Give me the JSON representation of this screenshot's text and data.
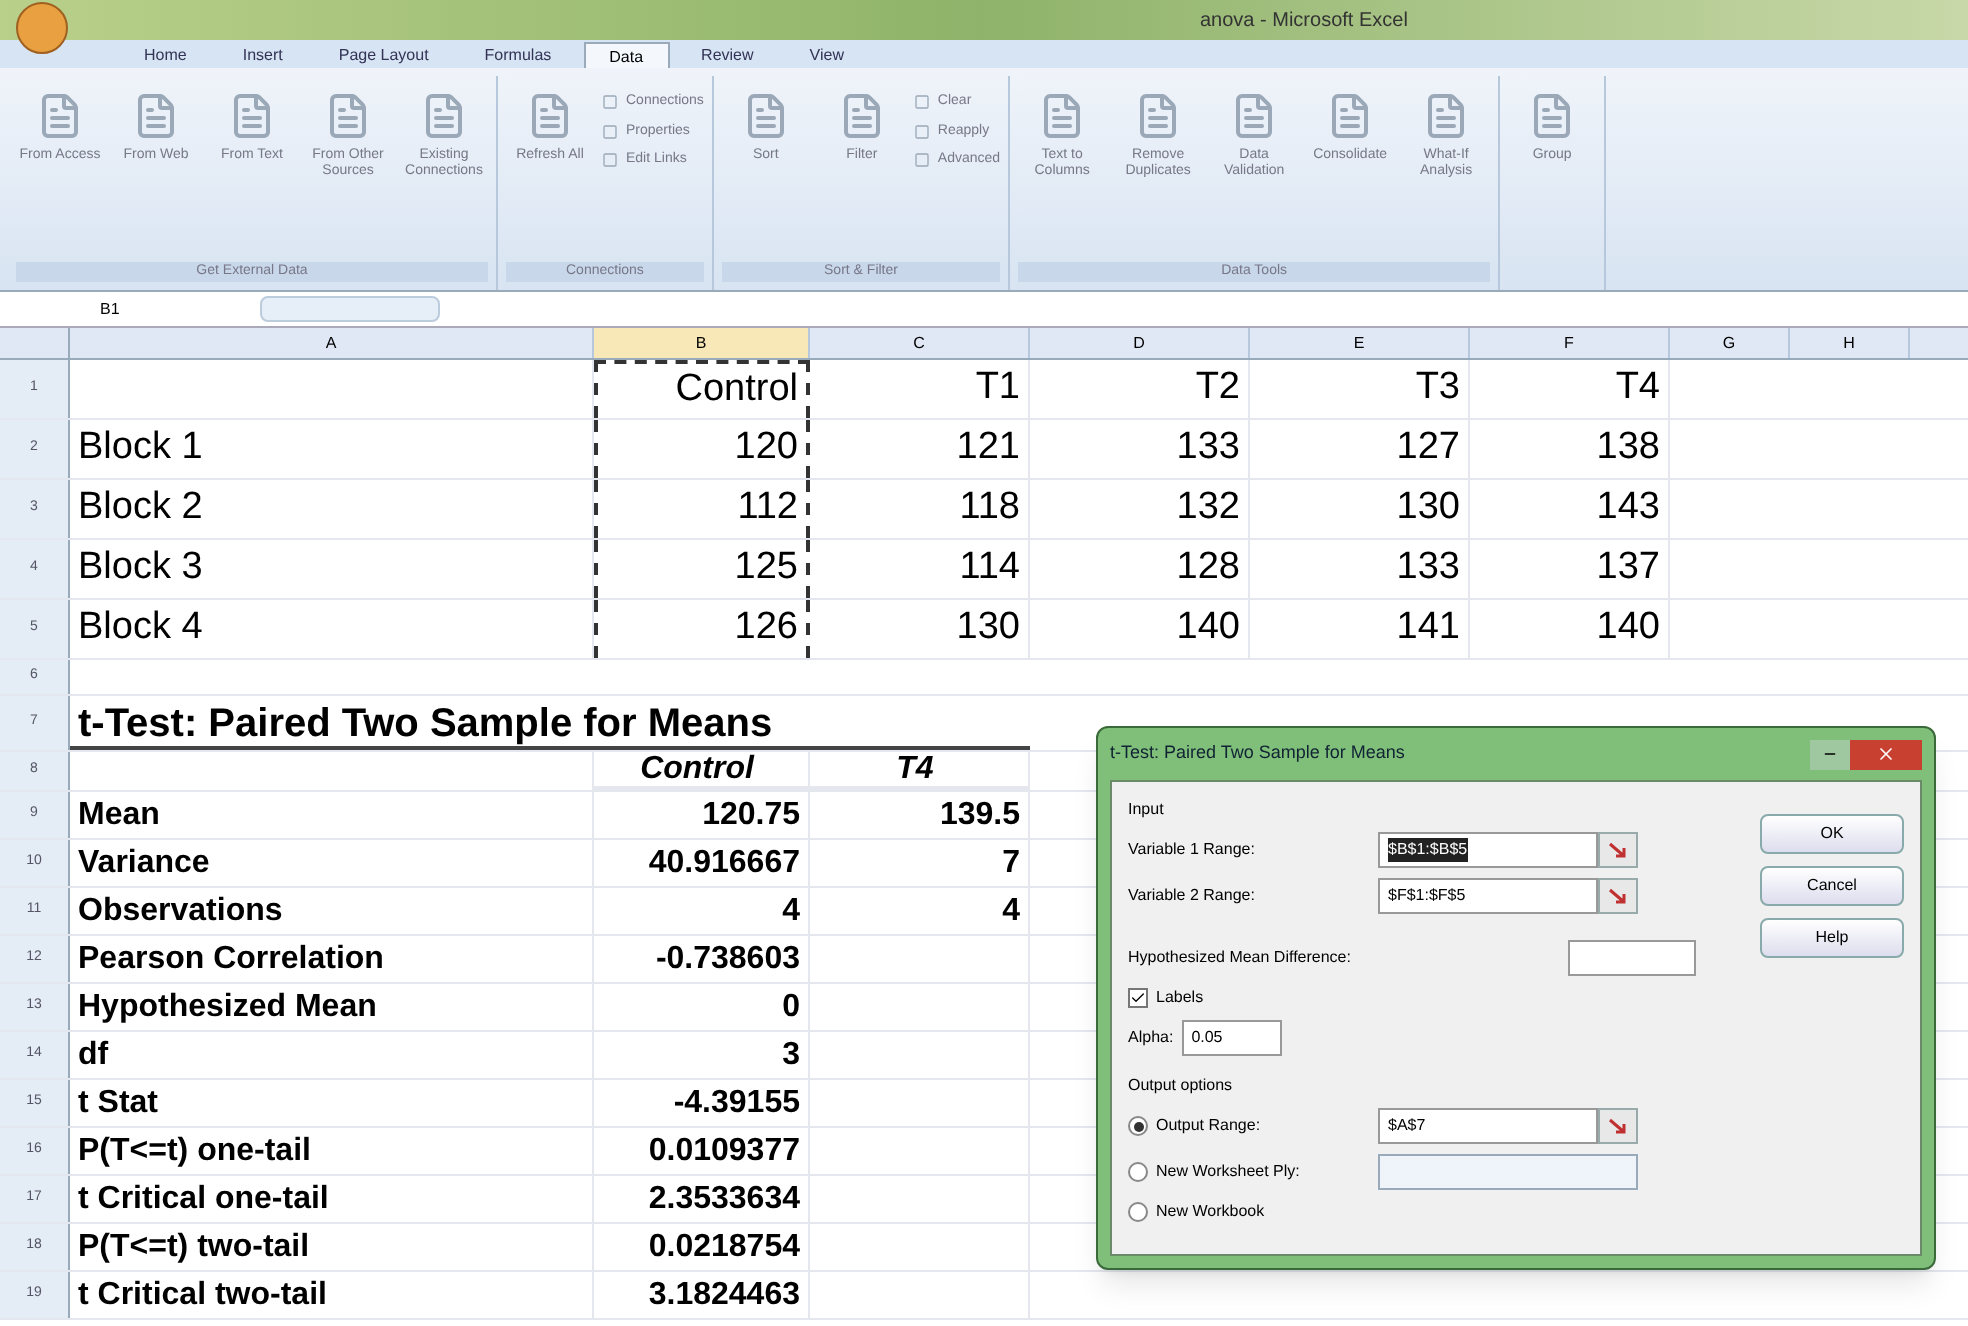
{
  "window": {
    "title": "anova - Microsoft Excel"
  },
  "ribbon_tabs": [
    {
      "label": "Home",
      "selected": false
    },
    {
      "label": "Insert",
      "selected": false
    },
    {
      "label": "Page Layout",
      "selected": false
    },
    {
      "label": "Formulas",
      "selected": false
    },
    {
      "label": "Data",
      "selected": true
    },
    {
      "label": "Review",
      "selected": false
    },
    {
      "label": "View",
      "selected": false
    }
  ],
  "ribbon_groups": [
    {
      "label": "Get External Data",
      "buttons": [
        {
          "label": "From Access",
          "kind": "large"
        },
        {
          "label": "From Web",
          "kind": "large"
        },
        {
          "label": "From Text",
          "kind": "large"
        },
        {
          "label": "From Other Sources",
          "kind": "large"
        },
        {
          "label": "Existing Connections",
          "kind": "large"
        }
      ]
    },
    {
      "label": "Connections",
      "buttons": [
        {
          "label": "Refresh All",
          "kind": "large"
        },
        {
          "label": "Connections",
          "kind": "small"
        },
        {
          "label": "Properties",
          "kind": "small"
        },
        {
          "label": "Edit Links",
          "kind": "small"
        }
      ]
    },
    {
      "label": "Sort & Filter",
      "buttons": [
        {
          "label": "Sort",
          "kind": "large"
        },
        {
          "label": "Filter",
          "kind": "large"
        },
        {
          "label": "Clear",
          "kind": "small"
        },
        {
          "label": "Reapply",
          "kind": "small"
        },
        {
          "label": "Advanced",
          "kind": "small"
        }
      ]
    },
    {
      "label": "Data Tools",
      "buttons": [
        {
          "label": "Text to Columns",
          "kind": "large"
        },
        {
          "label": "Remove Duplicates",
          "kind": "large"
        },
        {
          "label": "Data Validation",
          "kind": "large"
        },
        {
          "label": "Consolidate",
          "kind": "large"
        },
        {
          "label": "What-If Analysis",
          "kind": "large"
        }
      ]
    },
    {
      "buttons": [
        {
          "label": "Group",
          "kind": "large"
        }
      ]
    }
  ],
  "formula_bar": {
    "name_box": "B1"
  },
  "columns": [
    {
      "label": "A",
      "selected": false
    },
    {
      "label": "B",
      "selected": true
    },
    {
      "label": "C",
      "selected": false
    },
    {
      "label": "D",
      "selected": false
    },
    {
      "label": "E",
      "selected": false
    },
    {
      "label": "F",
      "selected": false
    },
    {
      "label": "G",
      "selected": false
    },
    {
      "label": "H",
      "selected": false
    }
  ],
  "rows": [
    {
      "number": "1",
      "kind": "data",
      "values": [
        "Control",
        "T1",
        "T2",
        "T3",
        "T4"
      ]
    },
    {
      "number": "2",
      "kind": "data",
      "label": "Block 1",
      "values": [
        "120",
        "121",
        "133",
        "127",
        "138"
      ]
    },
    {
      "number": "3",
      "kind": "data",
      "label": "Block 2",
      "values": [
        "112",
        "118",
        "132",
        "130",
        "143"
      ]
    },
    {
      "number": "4",
      "kind": "data",
      "label": "Block 3",
      "values": [
        "125",
        "114",
        "128",
        "133",
        "137"
      ]
    },
    {
      "number": "5",
      "kind": "data",
      "label": "Block 4",
      "values": [
        "126",
        "130",
        "140",
        "141",
        "140"
      ]
    },
    {
      "number": "6",
      "kind": "blank"
    },
    {
      "number": "7",
      "kind": "title",
      "label": "t-Test: Paired Two Sample for Means"
    },
    {
      "number": "8",
      "kind": "header",
      "values": [
        "Control",
        "T4"
      ]
    },
    {
      "number": "9",
      "kind": "stat",
      "label": "Mean",
      "values": [
        "120.75",
        "139.5"
      ]
    },
    {
      "number": "10",
      "kind": "stat",
      "label": "Variance",
      "values": [
        "40.916667",
        "7"
      ]
    },
    {
      "number": "11",
      "kind": "stat",
      "label": "Observations",
      "values": [
        "4",
        "4"
      ]
    },
    {
      "number": "12",
      "kind": "stat",
      "label": "Pearson Correlation",
      "values": [
        "-0.738603"
      ]
    },
    {
      "number": "13",
      "kind": "stat",
      "label": "Hypothesized Mean",
      "values": [
        "0"
      ]
    },
    {
      "number": "14",
      "kind": "stat",
      "label": "df",
      "values": [
        "3"
      ]
    },
    {
      "number": "15",
      "kind": "stat",
      "label": "t Stat",
      "values": [
        "-4.39155"
      ]
    },
    {
      "number": "16",
      "kind": "stat",
      "label": "P(T<=t) one-tail",
      "values": [
        "0.0109377"
      ]
    },
    {
      "number": "17",
      "kind": "stat",
      "label": "t Critical one-tail",
      "values": [
        "2.3533634"
      ]
    },
    {
      "number": "18",
      "kind": "stat",
      "label": "P(T<=t) two-tail",
      "values": [
        "0.0218754"
      ]
    },
    {
      "number": "19",
      "kind": "stat",
      "label": "t Critical two-tail",
      "values": [
        "3.1824463"
      ]
    }
  ],
  "dialog": {
    "title": "t-Test: Paired Two Sample for Means",
    "input_label": "Input",
    "range_fields": [
      {
        "label": "Variable 1 Range:",
        "value": "$B$1:$B$5",
        "highlighted": true
      },
      {
        "label": "Variable 2 Range:",
        "value": "$F$1:$F$5",
        "highlighted": false
      }
    ],
    "hypothesized_label": "Hypothesized Mean Difference:",
    "labels_checkbox": {
      "label": "Labels",
      "checked": true
    },
    "alpha": {
      "label": "Alpha:",
      "value": "0.05"
    },
    "output_label": "Output options",
    "output_options": [
      {
        "label": "Output Range:",
        "selected": true,
        "value": "$A$7"
      },
      {
        "label": "New Worksheet Ply:",
        "selected": false,
        "field": true
      },
      {
        "label": "New Workbook",
        "selected": false
      }
    ],
    "buttons": [
      "OK",
      "Cancel",
      "Help"
    ]
  }
}
